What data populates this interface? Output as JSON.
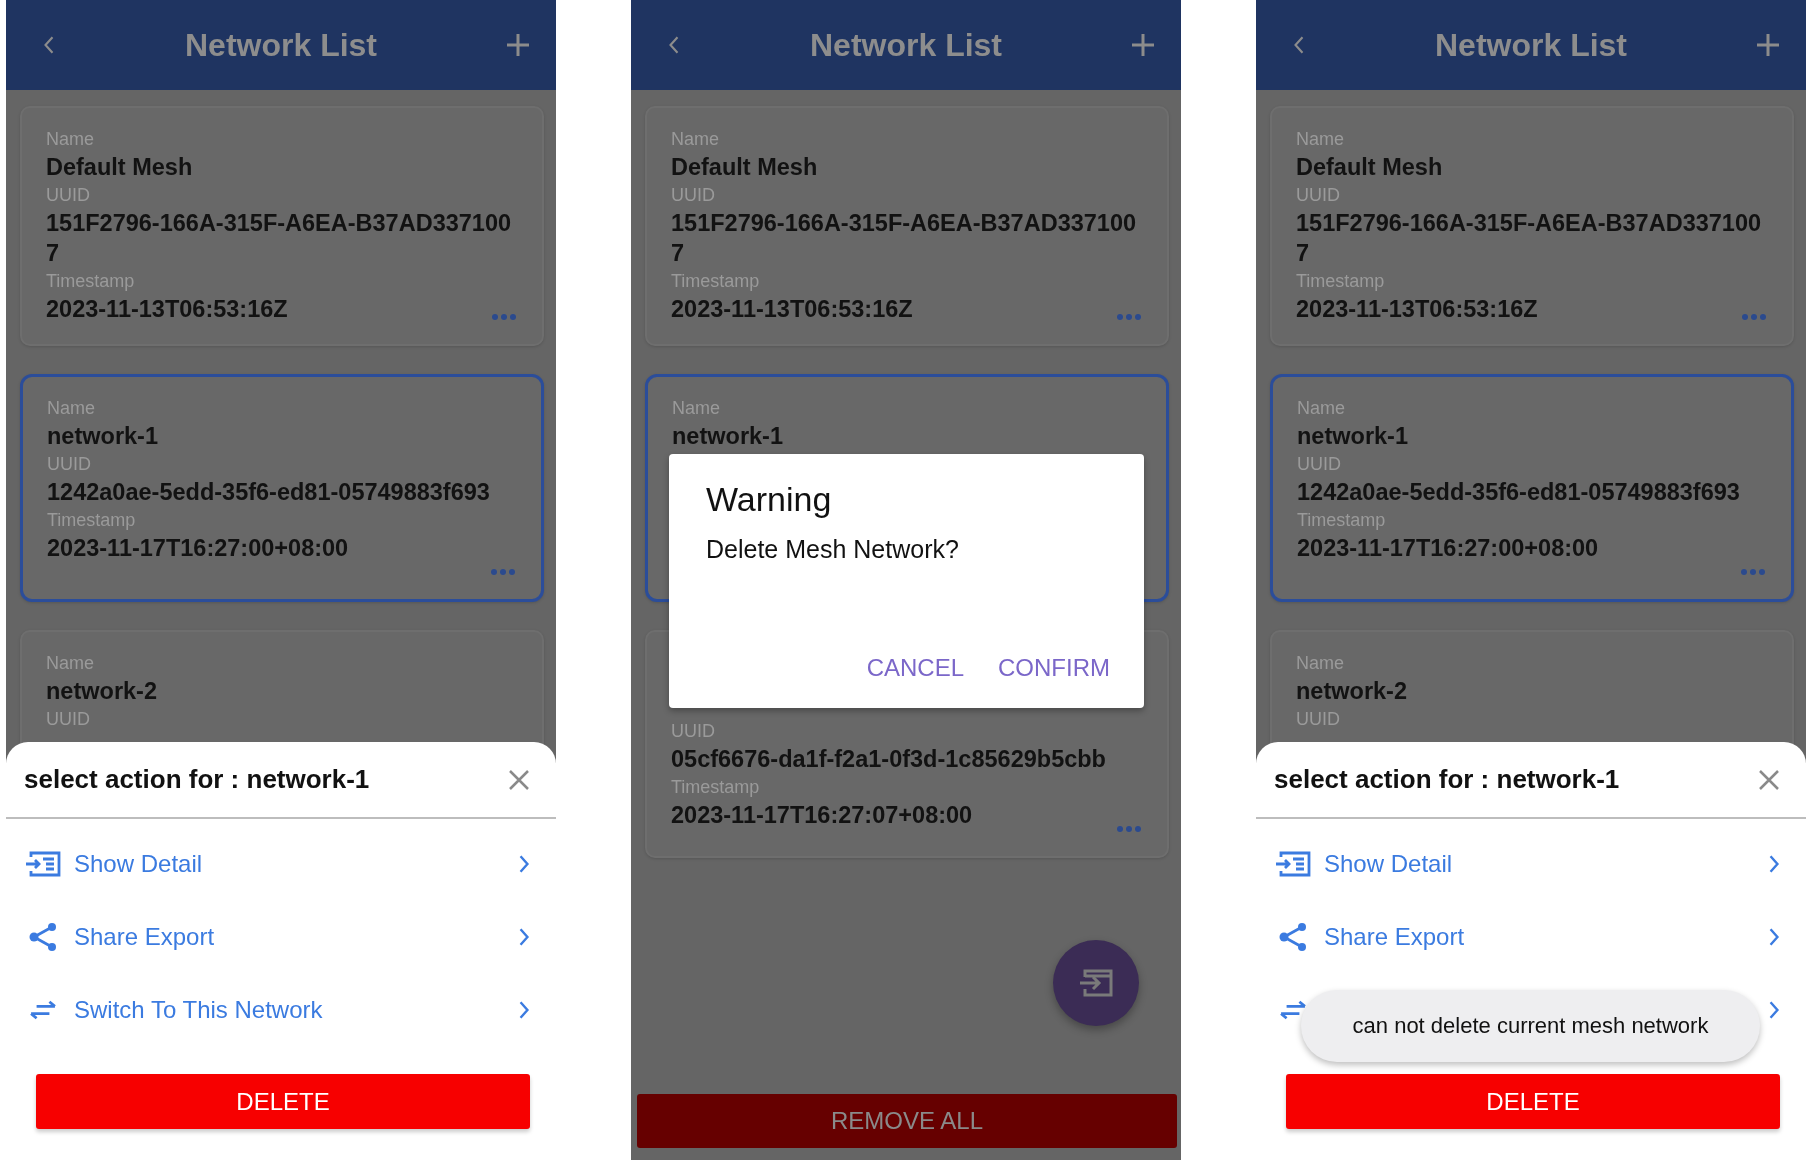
{
  "screens": [
    {
      "header": {
        "title": "Network List"
      },
      "networks": [
        {
          "selected": false,
          "more_button": true,
          "fields": [
            {
              "label": "Name",
              "value": "Default Mesh"
            },
            {
              "label": "UUID",
              "value": "151F2796-166A-315F-A6EA-B37AD3371007"
            },
            {
              "label": "Timestamp",
              "value": "2023-11-13T06:53:16Z"
            }
          ]
        },
        {
          "selected": true,
          "more_button": true,
          "fields": [
            {
              "label": "Name",
              "value": "network-1"
            },
            {
              "label": "UUID",
              "value": "1242a0ae-5edd-35f6-ed81-05749883f693"
            },
            {
              "label": "Timestamp",
              "value": "2023-11-17T16:27:00+08:00"
            }
          ]
        },
        {
          "selected": false,
          "more_button": false,
          "fields": [
            {
              "label": "Name",
              "value": "network-2"
            },
            {
              "label": "UUID"
            }
          ]
        }
      ],
      "action_sheet": {
        "title": "select action for : network-1",
        "items": [
          {
            "kind": "detail",
            "label": "Show Detail"
          },
          {
            "kind": "share",
            "label": "Share Export"
          },
          {
            "kind": "switch",
            "label": "Switch To This Network"
          }
        ],
        "delete_button": "DELETE"
      }
    },
    {
      "header": {
        "title": "Network List"
      },
      "networks": [
        {
          "selected": false,
          "more_button": true,
          "fields": [
            {
              "label": "Name",
              "value": "Default Mesh"
            },
            {
              "label": "UUID",
              "value": "151F2796-166A-315F-A6EA-B37AD3371007"
            },
            {
              "label": "Timestamp",
              "value": "2023-11-13T06:53:16Z"
            }
          ]
        },
        {
          "selected": true,
          "more_button": true,
          "fields": [
            {
              "label": "Name",
              "value": "network-1"
            }
          ]
        },
        {
          "kind": "lower-part",
          "selected": false,
          "more_button": true,
          "fields": [
            {
              "label": "UUID",
              "value": "05cf6676-da1f-f2a1-0f3d-1c85629b5cbb"
            },
            {
              "label": "Timestamp",
              "value": "2023-11-17T16:27:07+08:00"
            }
          ]
        }
      ],
      "dialog": {
        "title": "Warning",
        "message": "Delete Mesh Network?",
        "buttons": [
          "CANCEL",
          "CONFIRM"
        ]
      },
      "fab": {
        "kind": "import"
      },
      "footer_button": "REMOVE ALL"
    },
    {
      "header": {
        "title": "Network List"
      },
      "networks": [
        {
          "selected": false,
          "more_button": true,
          "fields": [
            {
              "label": "Name",
              "value": "Default Mesh"
            },
            {
              "label": "UUID",
              "value": "151F2796-166A-315F-A6EA-B37AD3371007"
            },
            {
              "label": "Timestamp",
              "value": "2023-11-13T06:53:16Z"
            }
          ]
        },
        {
          "selected": true,
          "more_button": true,
          "fields": [
            {
              "label": "Name",
              "value": "network-1"
            },
            {
              "label": "UUID",
              "value": "1242a0ae-5edd-35f6-ed81-05749883f693"
            },
            {
              "label": "Timestamp",
              "value": "2023-11-17T16:27:00+08:00"
            }
          ]
        },
        {
          "selected": false,
          "more_button": false,
          "fields": [
            {
              "label": "Name",
              "value": "network-2"
            },
            {
              "label": "UUID"
            }
          ]
        }
      ],
      "action_sheet": {
        "title": "select action for : network-1",
        "items": [
          {
            "kind": "detail",
            "label": "Show Detail"
          },
          {
            "kind": "share",
            "label": "Share Export"
          },
          {
            "kind": "switch"
          }
        ],
        "delete_button": "DELETE"
      },
      "toast": "can not delete current mesh network"
    }
  ]
}
